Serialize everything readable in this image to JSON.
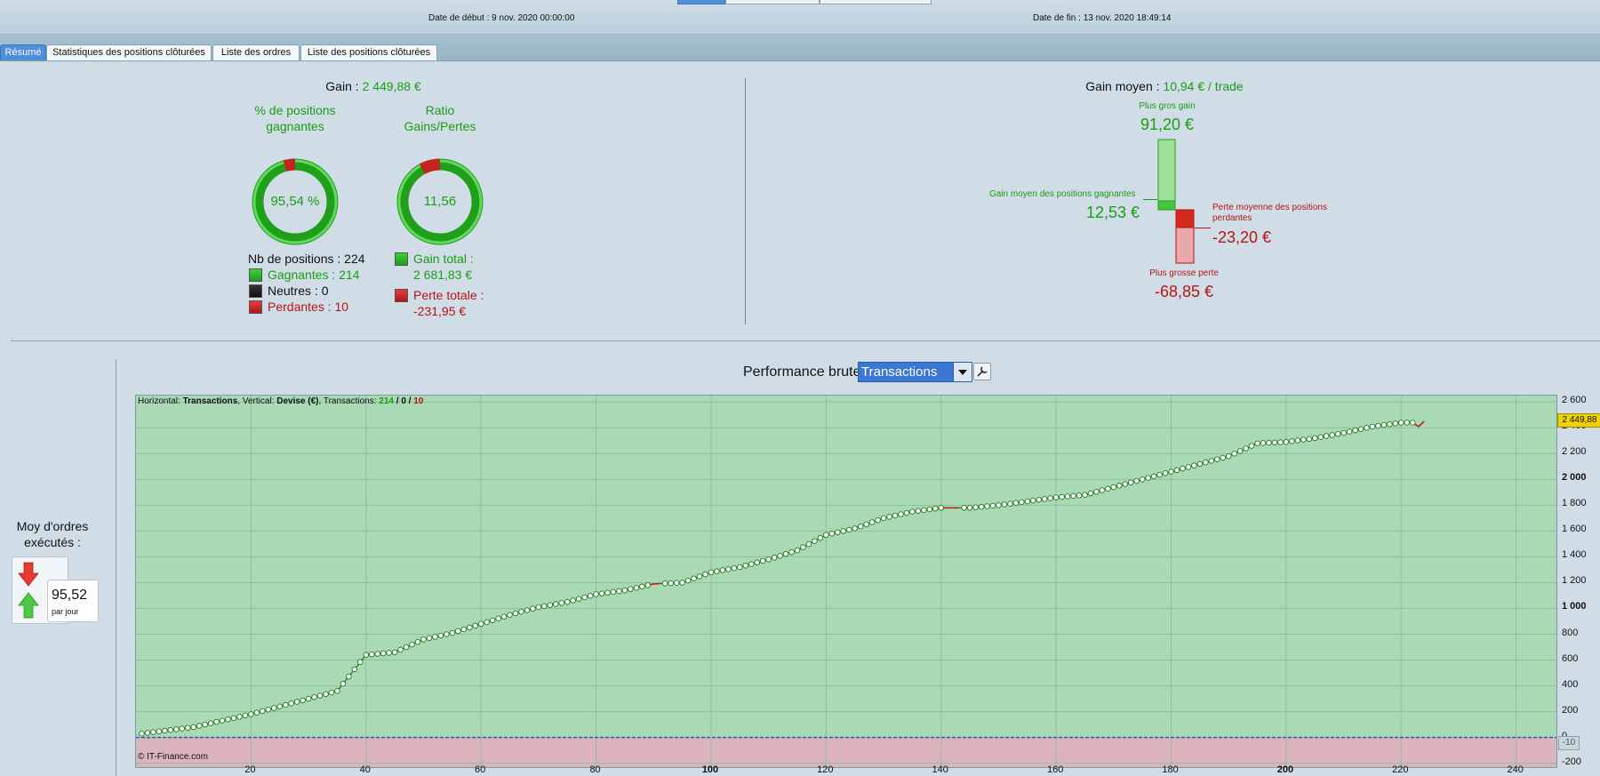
{
  "header": {
    "date_debut_label": "Date de début :",
    "date_debut_value": "9 nov. 2020 00:00:00",
    "date_fin_label": "Date de fin :",
    "date_fin_value": "13 nov. 2020 18:49:14"
  },
  "tabs": [
    {
      "label": "Résumé",
      "active": true
    },
    {
      "label": "Statistiques des positions clôturées",
      "active": false
    },
    {
      "label": "Liste des ordres",
      "active": false
    },
    {
      "label": "Liste des positions clôturées",
      "active": false
    }
  ],
  "summary": {
    "gain_label": "Gain :",
    "gain_value": "2 449,88 €",
    "pct_title": "% de positions gagnantes",
    "pct_value": "95,54 %",
    "pct_fraction": 0.9554,
    "ratio_title": "Ratio Gains/Pertes",
    "ratio_value": "11,56",
    "ratio_fraction": 0.9204,
    "nb_positions": "Nb de positions : 224",
    "gagnantes": "Gagnantes : 214",
    "neutres": "Neutres : 0",
    "perdantes": "Perdantes : 10",
    "gain_total_label": "Gain total :",
    "gain_total_value": "2 681,83 €",
    "perte_totale_label": "Perte totale :",
    "perte_totale_value": "-231,95 €"
  },
  "gain_moyen": {
    "label": "Gain moyen :",
    "value": "10,94 € / trade",
    "plus_gros_gain_label": "Plus gros gain",
    "plus_gros_gain_value": "91,20 €",
    "gain_moyen_gagnantes_label": "Gain moyen des positions gagnantes",
    "gain_moyen_gagnantes_value": "12,53 €",
    "perte_moyenne_label_1": "Perte moyenne des positions",
    "perte_moyenne_label_2": "perdantes",
    "perte_moyenne_value": "-23,20 €",
    "plus_grosse_perte_label": "Plus grosse perte",
    "plus_grosse_perte_value": "-68,85 €"
  },
  "orders": {
    "label_1": "Moy d'ordres",
    "label_2": "exécutés :",
    "value": "95,52",
    "unit": "par jour"
  },
  "performance": {
    "title": "Performance brute",
    "select_value": "Transactions",
    "info_prefix": "Horizontal:",
    "info_h": "Transactions",
    "info_v_prefix": ", Vertical:",
    "info_v": "Devise (€)",
    "info_t_prefix": ", Transactions:",
    "info_t_win": "214",
    "info_sep1": " / ",
    "info_t_neutral": "0",
    "info_sep2": " / ",
    "info_t_loss": "10",
    "copyright": "© IT-Finance.com",
    "last_value_tag": "2 449,88",
    "min_tag": "-10"
  },
  "colors": {
    "accent": "#4d8fd8",
    "green": "#1c9c16",
    "red": "#b51515",
    "chart_green_bg": "#a9d9b5",
    "chart_red_bg": "#dcb4bd"
  },
  "chart_data": {
    "type": "line",
    "xlabel": "",
    "ylabel": "",
    "xlim": [
      0,
      247
    ],
    "ylim": [
      -230,
      2650
    ],
    "x_ticks": [
      20,
      40,
      60,
      80,
      100,
      120,
      140,
      160,
      180,
      200,
      220,
      240
    ],
    "y_ticks": [
      "2 600",
      "2 400",
      "2 200",
      "2 000",
      "1 800",
      "1 600",
      "1 400",
      "1 200",
      "1 000",
      "800",
      "600",
      "400",
      "200",
      "0",
      "-200"
    ],
    "y_tick_values": [
      2600,
      2400,
      2200,
      2000,
      1800,
      1600,
      1400,
      1200,
      1000,
      800,
      600,
      400,
      200,
      0,
      -200
    ],
    "anchors": [
      [
        1,
        30
      ],
      [
        10,
        80
      ],
      [
        20,
        180
      ],
      [
        30,
        300
      ],
      [
        35,
        360
      ],
      [
        40,
        640
      ],
      [
        45,
        660
      ],
      [
        50,
        760
      ],
      [
        55,
        810
      ],
      [
        60,
        880
      ],
      [
        65,
        950
      ],
      [
        70,
        1010
      ],
      [
        75,
        1050
      ],
      [
        80,
        1110
      ],
      [
        85,
        1140
      ],
      [
        90,
        1190
      ],
      [
        95,
        1200
      ],
      [
        100,
        1280
      ],
      [
        105,
        1320
      ],
      [
        110,
        1380
      ],
      [
        115,
        1450
      ],
      [
        120,
        1570
      ],
      [
        125,
        1620
      ],
      [
        130,
        1700
      ],
      [
        135,
        1750
      ],
      [
        140,
        1780
      ],
      [
        145,
        1780
      ],
      [
        150,
        1800
      ],
      [
        155,
        1830
      ],
      [
        160,
        1860
      ],
      [
        165,
        1880
      ],
      [
        170,
        1940
      ],
      [
        175,
        2000
      ],
      [
        180,
        2060
      ],
      [
        185,
        2120
      ],
      [
        190,
        2180
      ],
      [
        195,
        2280
      ],
      [
        200,
        2290
      ],
      [
        205,
        2320
      ],
      [
        210,
        2360
      ],
      [
        215,
        2410
      ],
      [
        220,
        2440
      ],
      [
        222,
        2440
      ],
      [
        223,
        2410
      ],
      [
        224,
        2449.88
      ]
    ],
    "loss_segments": [
      [
        89,
        91
      ],
      [
        140,
        143
      ],
      [
        222,
        224
      ]
    ],
    "last_value": 2449.88
  }
}
